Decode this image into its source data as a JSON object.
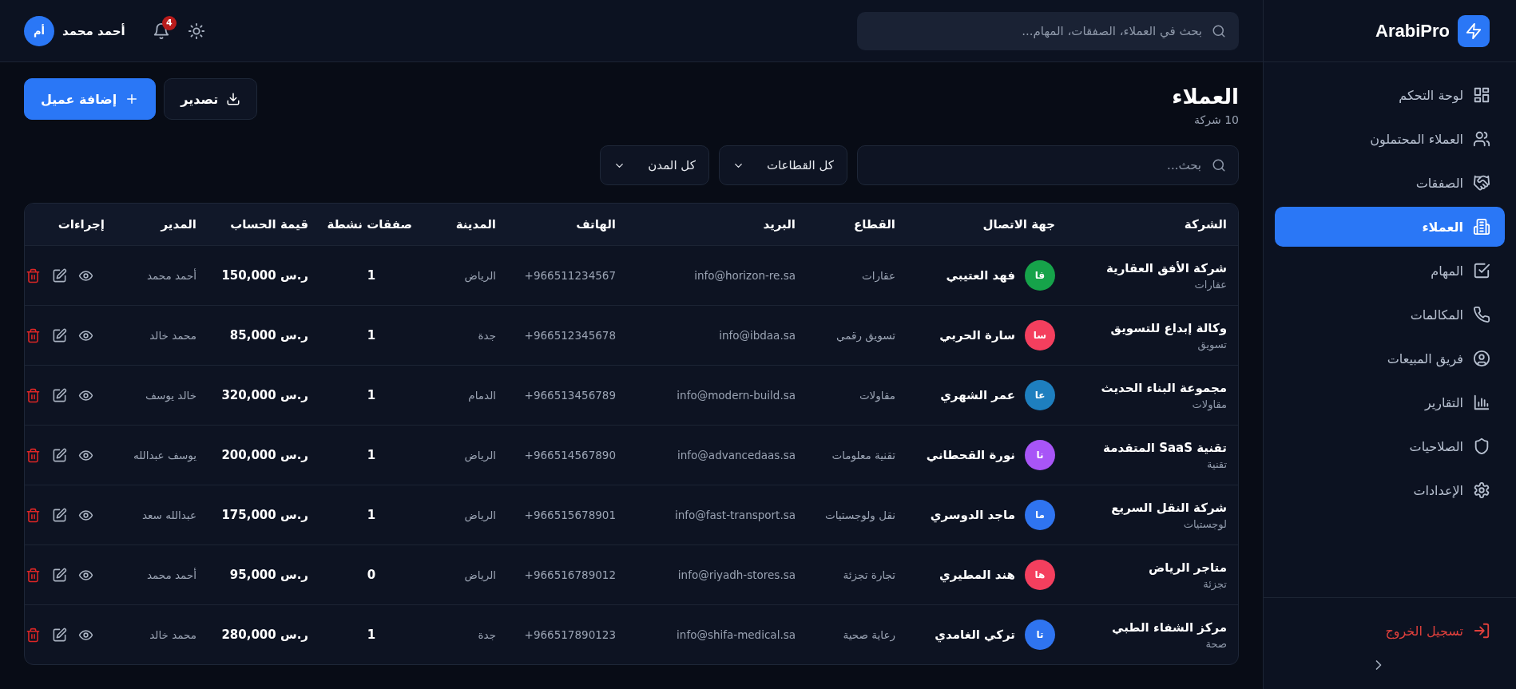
{
  "brand": {
    "name": "ArabiPro"
  },
  "sidebar": {
    "items": [
      {
        "label": "لوحة التحكم",
        "selected": false
      },
      {
        "label": "العملاء المحتملون",
        "selected": false
      },
      {
        "label": "الصفقات",
        "selected": false
      },
      {
        "label": "العملاء",
        "selected": true
      },
      {
        "label": "المهام",
        "selected": false
      },
      {
        "label": "المكالمات",
        "selected": false
      },
      {
        "label": "فريق المبيعات",
        "selected": false
      },
      {
        "label": "التقارير",
        "selected": false
      },
      {
        "label": "الصلاحيات",
        "selected": false
      },
      {
        "label": "الإعدادات",
        "selected": false
      }
    ],
    "logout": "تسجيل الخروج"
  },
  "header": {
    "search": {
      "placeholder": "بحث في العملاء، الصفقات، المهام..."
    },
    "notifications": {
      "count": "4"
    },
    "user": {
      "name": "أحمد محمد",
      "initials": "أم"
    }
  },
  "page": {
    "title": "العملاء",
    "subtitle": "10 شركة",
    "export_button": "تصدير",
    "add_button": "إضافة عميل"
  },
  "filters": {
    "search": {
      "placeholder": "بحث..."
    },
    "sector": "كل القطاعات",
    "city": "كل المدن"
  },
  "table": {
    "columns": [
      "الشركة",
      "جهة الاتصال",
      "القطاع",
      "البريد",
      "الهاتف",
      "المدينة",
      "صفقات نشطة",
      "قيمة الحساب",
      "المدير",
      "إجراءات"
    ],
    "rows": [
      {
        "company": "شركة الأفق العقارية",
        "company_sector": "عقارات",
        "initials": "فا",
        "color": "#16a34a",
        "contact": "فهد العتيبي",
        "sector": "عقارات",
        "email": "info@horizon-re.sa",
        "phone": "+966511234567",
        "city": "الرياض",
        "deals": "1",
        "value": "150,000 ر.س",
        "manager": "أحمد محمد"
      },
      {
        "company": "وكالة إبداع للتسويق",
        "company_sector": "تسويق",
        "initials": "سا",
        "color": "#f43f5e",
        "contact": "سارة الحربي",
        "sector": "تسويق رقمي",
        "email": "info@ibdaa.sa",
        "phone": "+966512345678",
        "city": "جدة",
        "deals": "1",
        "value": "85,000 ر.س",
        "manager": "محمد خالد"
      },
      {
        "company": "مجموعة البناء الحديث",
        "company_sector": "مقاولات",
        "initials": "عا",
        "color": "#1e7fbf",
        "contact": "عمر الشهري",
        "sector": "مقاولات",
        "email": "info@modern-build.sa",
        "phone": "+966513456789",
        "city": "الدمام",
        "deals": "1",
        "value": "320,000 ر.س",
        "manager": "خالد يوسف"
      },
      {
        "company": "تقنية SaaS المتقدمة",
        "company_sector": "تقنية",
        "initials": "نا",
        "color": "#a855f7",
        "contact": "نورة القحطاني",
        "sector": "تقنية معلومات",
        "email": "info@advancedaas.sa",
        "phone": "+966514567890",
        "city": "الرياض",
        "deals": "1",
        "value": "200,000 ر.س",
        "manager": "يوسف عبدالله"
      },
      {
        "company": "شركة النقل السريع",
        "company_sector": "لوجستيات",
        "initials": "ما",
        "color": "#2f74f0",
        "contact": "ماجد الدوسري",
        "sector": "نقل ولوجستيات",
        "email": "info@fast-transport.sa",
        "phone": "+966515678901",
        "city": "الرياض",
        "deals": "1",
        "value": "175,000 ر.س",
        "manager": "عبدالله سعد"
      },
      {
        "company": "متاجر الرياض",
        "company_sector": "تجزئة",
        "initials": "ها",
        "color": "#f43f5e",
        "contact": "هند المطيري",
        "sector": "تجارة تجزئة",
        "email": "info@riyadh-stores.sa",
        "phone": "+966516789012",
        "city": "الرياض",
        "deals": "0",
        "value": "95,000 ر.س",
        "manager": "أحمد محمد"
      },
      {
        "company": "مركز الشفاء الطبي",
        "company_sector": "صحة",
        "initials": "تا",
        "color": "#2f74f0",
        "contact": "تركي الغامدي",
        "sector": "رعاية صحية",
        "email": "info@shifa-medical.sa",
        "phone": "+966517890123",
        "city": "جدة",
        "deals": "1",
        "value": "280,000 ر.س",
        "manager": "محمد خالد"
      }
    ]
  }
}
